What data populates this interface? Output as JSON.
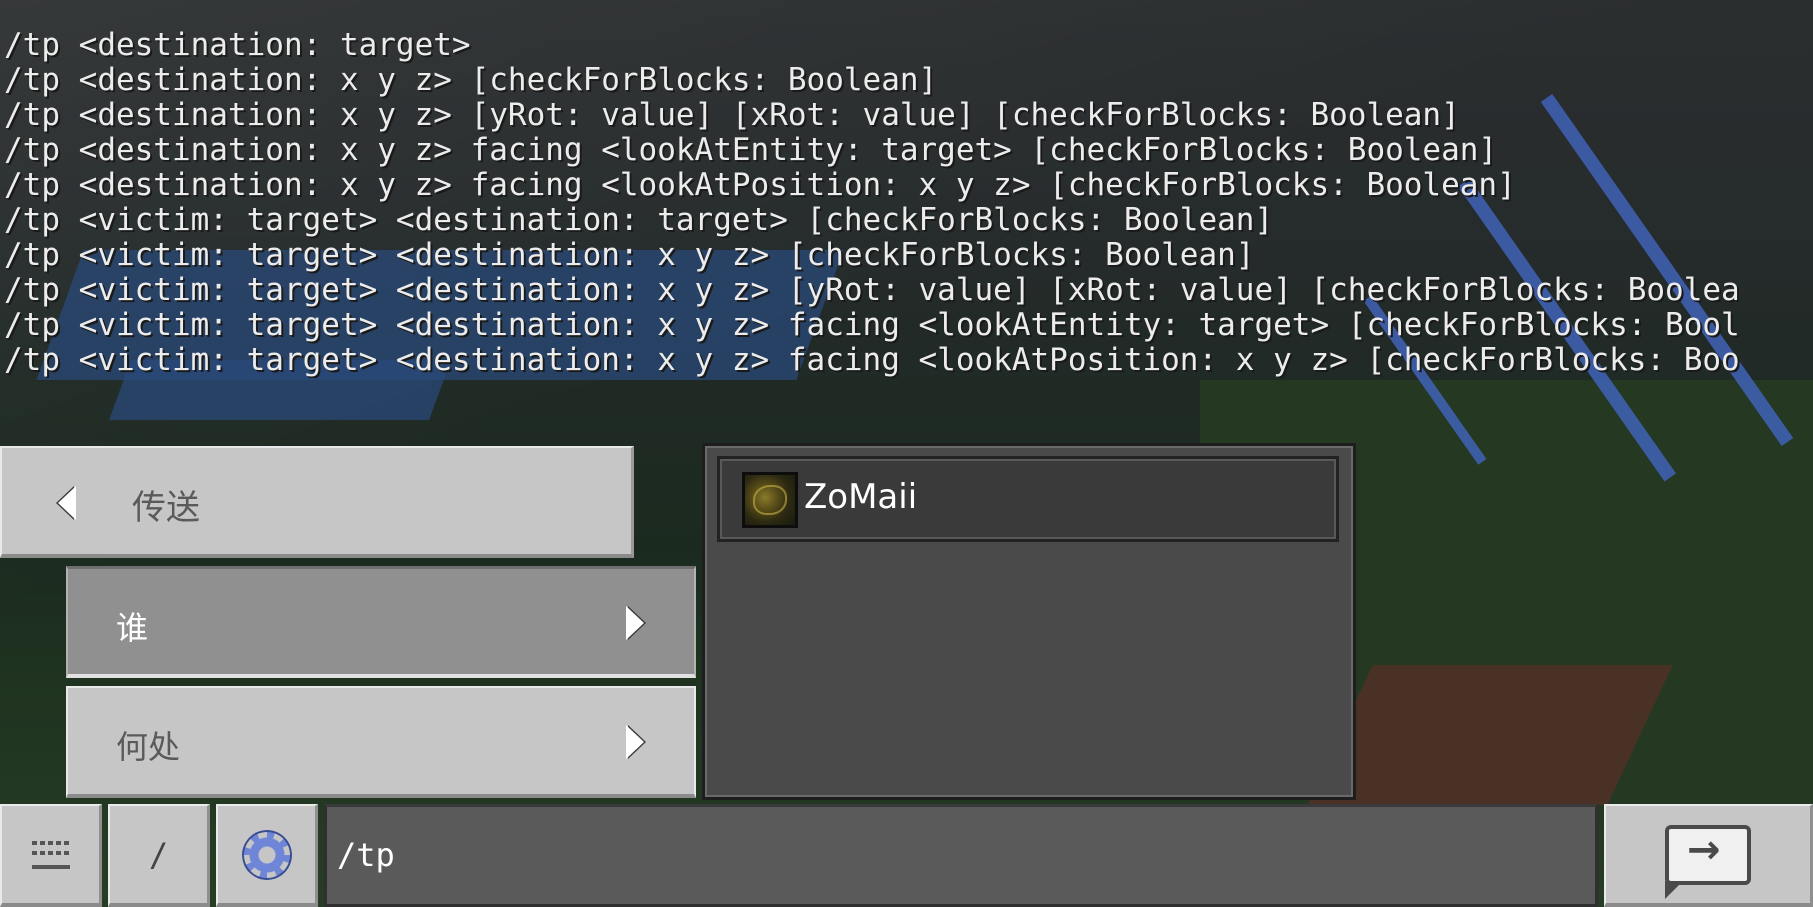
{
  "chat": {
    "lines": [
      "/tp <destination: target>",
      "/tp <destination: x y z> [checkForBlocks: Boolean]",
      "/tp <destination: x y z> [yRot: value] [xRot: value] [checkForBlocks: Boolean]",
      "/tp <destination: x y z> facing <lookAtEntity: target> [checkForBlocks: Boolean]",
      "/tp <destination: x y z> facing <lookAtPosition: x y z> [checkForBlocks: Boolean]",
      "/tp <victim: target> <destination: target> [checkForBlocks: Boolean]",
      "/tp <victim: target> <destination: x y z> [checkForBlocks: Boolean]",
      "/tp <victim: target> <destination: x y z> [yRot: value] [xRot: value] [checkForBlocks: Boolea",
      "/tp <victim: target> <destination: x y z> facing <lookAtEntity: target> [checkForBlocks: Bool",
      "/tp <victim: target> <destination: x y z> facing <lookAtPosition: x y z> [checkForBlocks: Boo"
    ]
  },
  "panel": {
    "title": "传送",
    "back_icon": "chevron-left-icon",
    "rows": [
      {
        "label": "谁",
        "icon": "chevron-right-icon",
        "selected": true
      },
      {
        "label": "何处",
        "icon": "chevron-right-icon",
        "selected": false
      }
    ]
  },
  "targets": [
    {
      "name": "ZoMaii",
      "icon": "player-skin-avatar"
    }
  ],
  "bottom_bar": {
    "keyboard_icon": "keyboard-icon",
    "slash_label": "/",
    "settings_icon": "gear-icon",
    "command_value": "/tp",
    "send_icon": "send-chat-icon"
  },
  "colors": {
    "button_gray": "#c6c6c6",
    "button_selected": "#909090",
    "panel_dark": "#4a4a4a",
    "input_bg": "#5a5a5a",
    "gear_blue": "#6f86d8"
  }
}
